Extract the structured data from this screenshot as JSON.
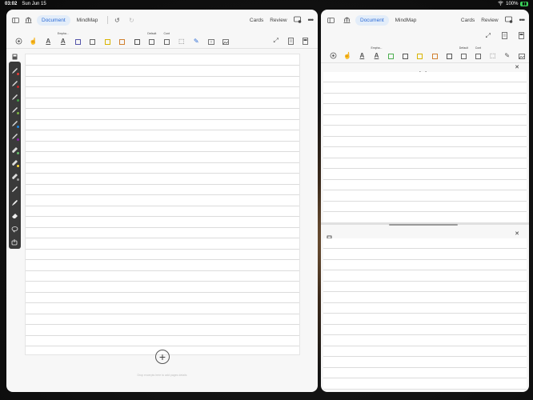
{
  "status": {
    "time": "03:02",
    "date": "Sun Jun 15",
    "battery": "100%"
  },
  "left": {
    "tabs": [
      "Document",
      "MindMap"
    ],
    "right_buttons": [
      "Cards",
      "Review"
    ],
    "tool_labels": {
      "emphasis": "Empha...",
      "default": "Default",
      "cont": "Cont"
    },
    "add_hint": "Drop excerpts here to add pages details"
  },
  "right": {
    "tabs": [
      "Document",
      "MindMap"
    ],
    "right_buttons": [
      "Cards",
      "Review"
    ],
    "tool_labels": {
      "emphasis": "Empha...",
      "default": "Default",
      "cont": "Cont"
    }
  },
  "colors": {
    "accent": "#2c6bd6",
    "palette_bg": "#3a3a3a",
    "battery": "#3bd15a"
  }
}
